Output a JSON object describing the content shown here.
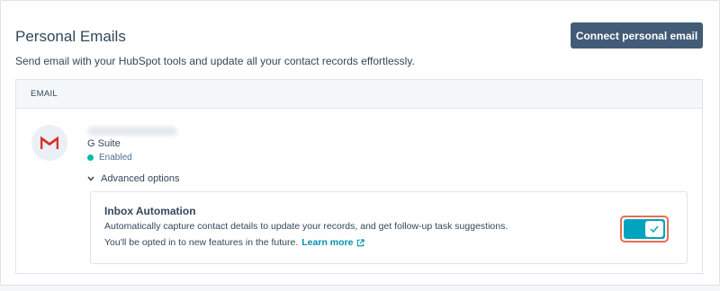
{
  "header": {
    "title": "Personal Emails",
    "subtitle": "Send email with your HubSpot tools and update all your contact records effortlessly.",
    "connect_button": "Connect personal email"
  },
  "table": {
    "column_header": "EMAIL",
    "row": {
      "icon": "gmail-icon",
      "provider": "G Suite",
      "status": "Enabled",
      "advanced_options": "Advanced options"
    }
  },
  "inbox_automation": {
    "title": "Inbox Automation",
    "description": "Automatically capture contact details to update your records, and get follow-up task suggestions.",
    "note": "You'll be opted in to new features in the future.",
    "learn_more": "Learn more",
    "toggle_on": true
  },
  "colors": {
    "primary_button": "#425b76",
    "toggle": "#00a4bd",
    "highlight_ring": "#e66e50",
    "status_enabled": "#00bda5",
    "link": "#0091ae"
  }
}
